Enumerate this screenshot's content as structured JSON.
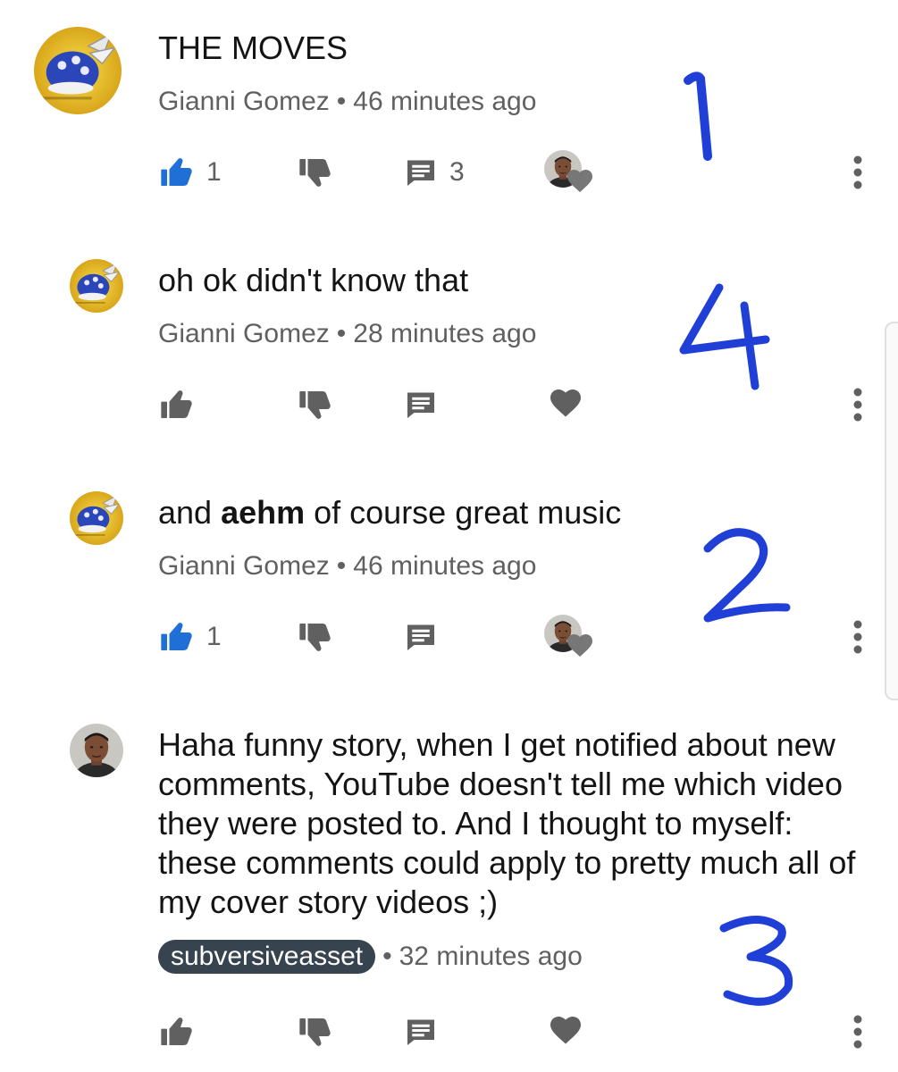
{
  "comments": [
    {
      "text_plain": "THE MOVES",
      "author": "Gianni Gomez",
      "separator": "•",
      "time": "46 minutes ago",
      "likes": "1",
      "liked": true,
      "replies": "3",
      "creator_hearted": true,
      "avatar": "blue-shell-avatar",
      "annotation": "1"
    },
    {
      "text_plain": "oh ok didn't know that",
      "author": "Gianni Gomez",
      "separator": "•",
      "time": "28 minutes ago",
      "liked": false,
      "creator_hearted": false,
      "avatar": "blue-shell-avatar",
      "annotation": "4"
    },
    {
      "text_before": "and ",
      "text_bold": "aehm",
      "text_after": " of course great music",
      "author": "Gianni Gomez",
      "separator": "•",
      "time": "46 minutes ago",
      "likes": "1",
      "liked": true,
      "creator_hearted": true,
      "avatar": "blue-shell-avatar",
      "annotation": "2"
    },
    {
      "text_plain": "Haha funny story, when I get notified about new comments, YouTube doesn't tell me which video they were posted to. And I thought to myself: these comments could apply to pretty much all of my cover story videos ;)",
      "author": "subversiveasset",
      "author_is_creator": true,
      "separator": "•",
      "time": "32 minutes ago",
      "liked": false,
      "creator_hearted": false,
      "avatar": "creator-avatar",
      "annotation": "3"
    }
  ],
  "colors": {
    "liked_blue": "#1f6fd6",
    "icon_grey": "#606060",
    "creator_chip": "#37444f",
    "annotation_ink": "#1f3fd6"
  }
}
